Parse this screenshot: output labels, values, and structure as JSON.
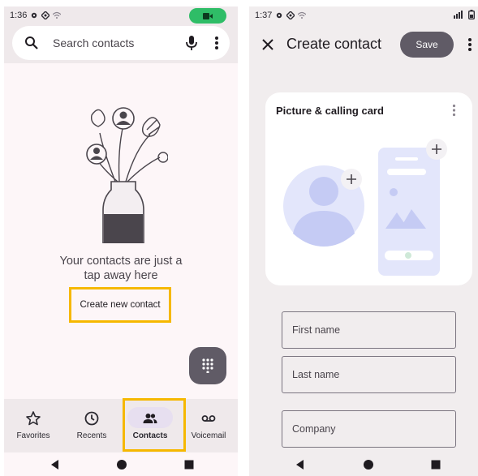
{
  "left": {
    "status": {
      "time": "1:36"
    },
    "search": {
      "placeholder": "Search contacts"
    },
    "empty_state": {
      "line1": "Your contacts are just a",
      "line2": "tap away here",
      "create_label": "Create new contact"
    },
    "nav": [
      {
        "label": "Favorites",
        "icon": "star-icon"
      },
      {
        "label": "Recents",
        "icon": "clock-icon"
      },
      {
        "label": "Contacts",
        "icon": "people-icon",
        "selected": true
      },
      {
        "label": "Voicemail",
        "icon": "voicemail-icon"
      }
    ]
  },
  "right": {
    "status": {
      "time": "1:37"
    },
    "title": "Create contact",
    "save_label": "Save",
    "card_title": "Picture & calling card",
    "fields": [
      "First name",
      "Last name",
      "Company"
    ]
  },
  "colors": {
    "highlight": "#f6b800",
    "record_pill": "#2fbd67",
    "primary_dark": "#605b66"
  }
}
